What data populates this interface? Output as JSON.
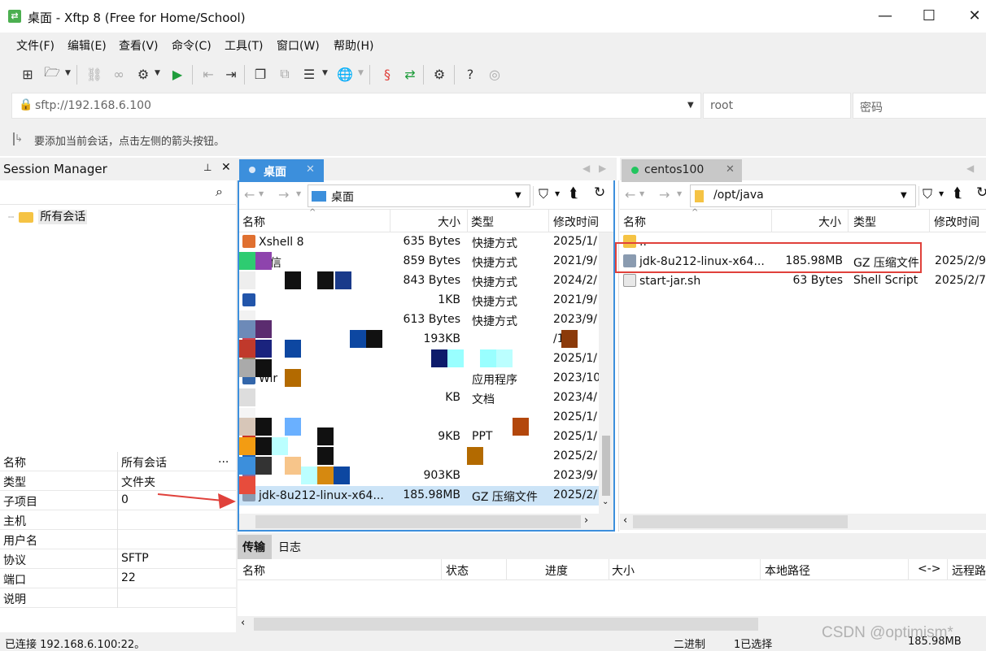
{
  "window": {
    "title": "桌面 - Xftp 8 (Free for Home/School)",
    "app_icon": "xftp-icon",
    "minimize": "—",
    "maximize": "☐",
    "close": "✕"
  },
  "menu": [
    "文件(F)",
    "编辑(E)",
    "查看(V)",
    "命令(C)",
    "工具(T)",
    "窗口(W)",
    "帮助(H)"
  ],
  "address": {
    "url": "sftp://192.168.6.100",
    "user": "root",
    "password_placeholder": "密码"
  },
  "hint": "要添加当前会话，点击左侧的箭头按钮。",
  "session_manager": {
    "title": "Session Manager",
    "pin": "📌",
    "close": "✕",
    "tree_root": "所有会话",
    "properties": [
      {
        "key": "名称",
        "value": "所有会话"
      },
      {
        "key": "类型",
        "value": "文件夹"
      },
      {
        "key": "子项目",
        "value": "0"
      },
      {
        "key": "主机",
        "value": ""
      },
      {
        "key": "用户名",
        "value": ""
      },
      {
        "key": "协议",
        "value": "SFTP"
      },
      {
        "key": "端口",
        "value": "22"
      },
      {
        "key": "说明",
        "value": ""
      }
    ],
    "more": "..."
  },
  "left_pane": {
    "tab": "桌面",
    "path": "桌面",
    "columns": [
      "名称",
      "大小",
      "类型",
      "修改时间"
    ],
    "rows": [
      {
        "name": "Xshell 8",
        "size": "635 Bytes",
        "type": "快捷方式",
        "date": "2025/1/"
      },
      {
        "name": "微信",
        "size": "859 Bytes",
        "type": "快捷方式",
        "date": "2021/9/"
      },
      {
        "name": "",
        "size": "843 Bytes",
        "type": "快捷方式",
        "date": "2024/2/"
      },
      {
        "name": "",
        "size": "1KB",
        "type": "快捷方式",
        "date": "2021/9/"
      },
      {
        "name": "",
        "size": "613 Bytes",
        "type": "快捷方式",
        "date": "2023/9/"
      },
      {
        "name": "",
        "size": "193KB",
        "type": "",
        "date": "/10"
      },
      {
        "name": "",
        "size": "",
        "type": "",
        "date": "2025/1/"
      },
      {
        "name": "Wir",
        "size": "",
        "type": "应用程序",
        "date": "2023/10"
      },
      {
        "name": "",
        "size": "KB",
        "type": "文档",
        "date": "2023/4/"
      },
      {
        "name": "",
        "size": "",
        "type": "",
        "date": "2025/1/"
      },
      {
        "name": "",
        "size": "9KB",
        "type": "PPT",
        "date": "2025/1/"
      },
      {
        "name": "",
        "size": "",
        "type": "文",
        "date": "2025/2/"
      },
      {
        "name": "",
        "size": "903KB",
        "type": "",
        "date": "2023/9/"
      },
      {
        "name": "jdk-8u212-linux-x64...",
        "size": "185.98MB",
        "type": "GZ 压缩文件",
        "date": "2025/2/"
      }
    ]
  },
  "right_pane": {
    "tab": "centos100",
    "path": "/opt/java",
    "columns": [
      "名称",
      "大小",
      "类型",
      "修改时间"
    ],
    "rows": [
      {
        "name": "..",
        "size": "",
        "type": "",
        "date": ""
      },
      {
        "name": "jdk-8u212-linux-x64...",
        "size": "185.98MB",
        "type": "GZ 压缩文件",
        "date": "2025/2/9"
      },
      {
        "name": "start-jar.sh",
        "size": "63 Bytes",
        "type": "Shell Script",
        "date": "2025/2/7"
      }
    ]
  },
  "transfer": {
    "tabs": [
      "传输",
      "日志"
    ],
    "columns": [
      "名称",
      "状态",
      "进度",
      "大小",
      "本地路径",
      "<->",
      "远程路"
    ]
  },
  "status": {
    "connection": "已连接 192.168.6.100:22。",
    "mode": "二进制",
    "selection": "1已选择",
    "size": "185.98MB",
    "watermark": "CSDN @optimism*"
  },
  "colors": {
    "accent": "#3c8fdc",
    "highlight": "#e0413b",
    "selection": "#cce4f7",
    "connected": "#22c55e"
  }
}
